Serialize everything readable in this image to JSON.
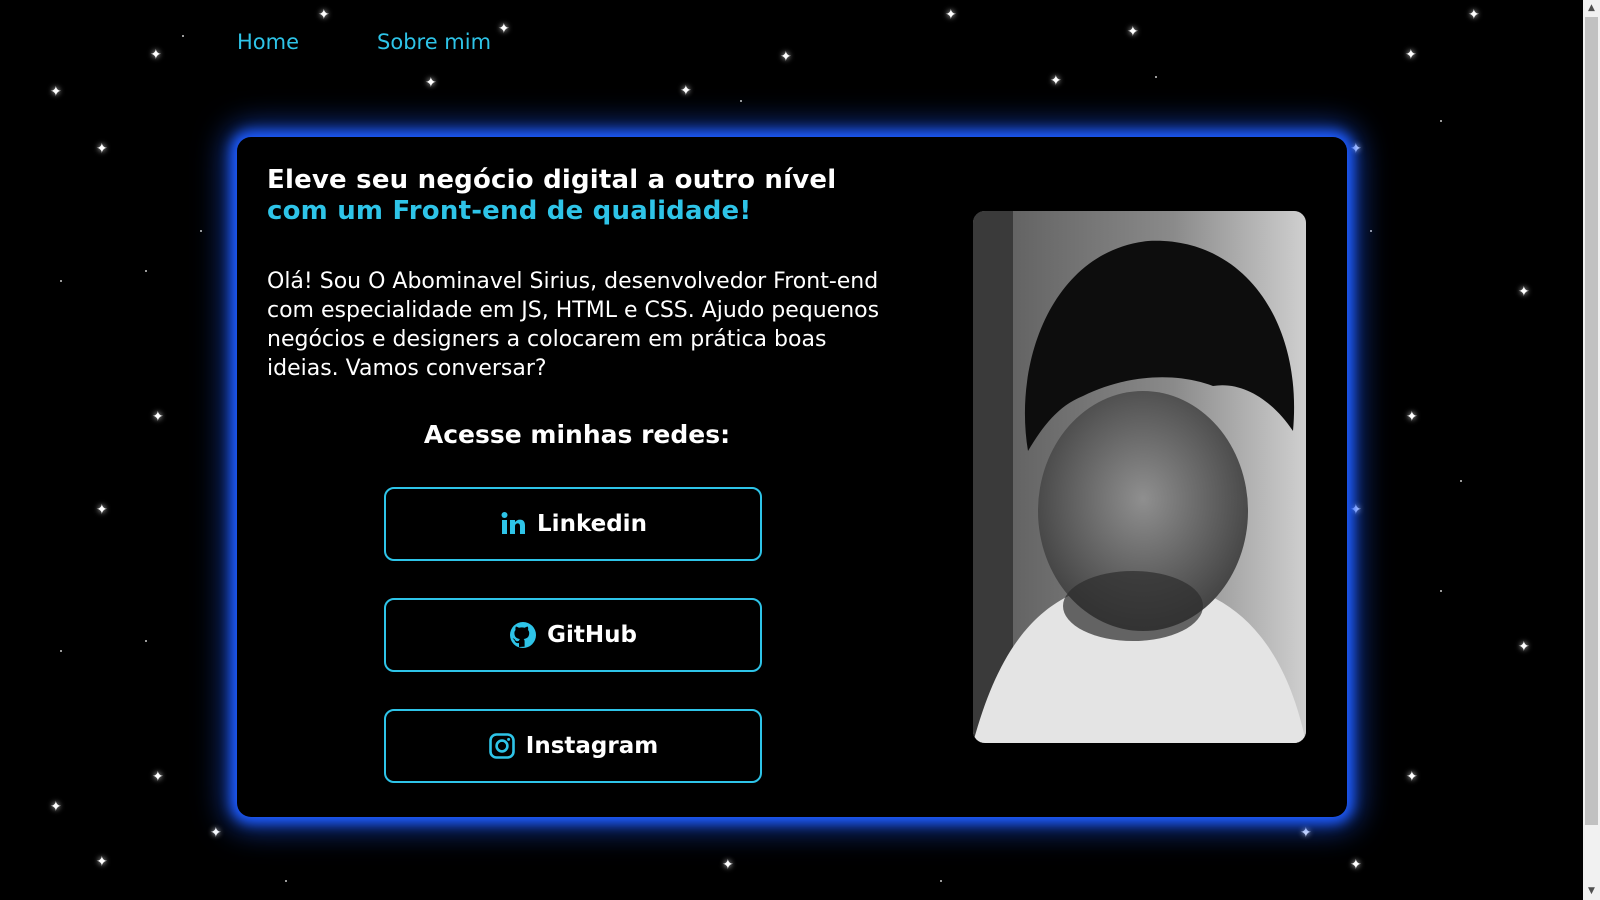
{
  "nav": {
    "items": [
      {
        "label": "Home"
      },
      {
        "label": "Sobre mim"
      }
    ]
  },
  "hero": {
    "headline_line1": "Eleve seu negócio digital a outro nível",
    "headline_line2": "com um Front-end de qualidade!",
    "bio": "Olá! Sou O Abominavel Sirius, desenvolvedor Front-end com especialidade em JS, HTML e CSS. Ajudo pequenos negócios e designers a colocarem em prática boas ideias. Vamos conversar?"
  },
  "social": {
    "title": "Acesse minhas redes:",
    "links": [
      {
        "label": "Linkedin",
        "icon": "linkedin-icon"
      },
      {
        "label": "GitHub",
        "icon": "github-icon"
      },
      {
        "label": "Instagram",
        "icon": "instagram-icon"
      }
    ]
  },
  "colors": {
    "accent": "#2ec4e8",
    "glow": "#1e5cff",
    "background": "#000000",
    "text": "#ffffff"
  }
}
